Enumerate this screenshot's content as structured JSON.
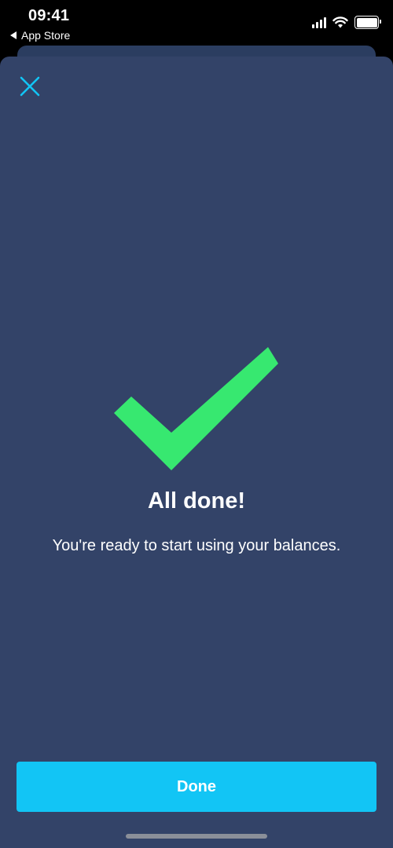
{
  "status_bar": {
    "time": "09:41",
    "back_app_label": "App Store",
    "icons": [
      "signal-icon",
      "wifi-icon",
      "battery-icon"
    ]
  },
  "sheet": {
    "close_icon": "close-icon",
    "success_icon": "checkmark-icon",
    "title": "All done!",
    "subtitle": "You're ready to start using your balances.",
    "done_button_label": "Done"
  },
  "colors": {
    "sheet_background": "#334368",
    "accent": "#12c5f5",
    "success": "#37e870",
    "close_icon": "#12c5f5"
  }
}
